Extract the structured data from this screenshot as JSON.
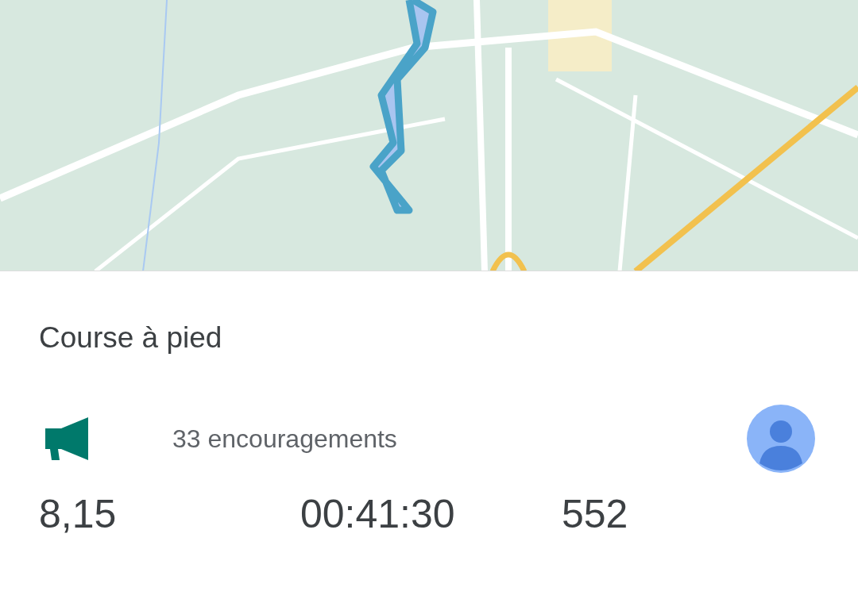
{
  "activity": {
    "title": "Course à pied"
  },
  "cheers": {
    "count_text": "33 encouragements"
  },
  "stats": [
    "8,15",
    "00:41:30",
    "552"
  ]
}
